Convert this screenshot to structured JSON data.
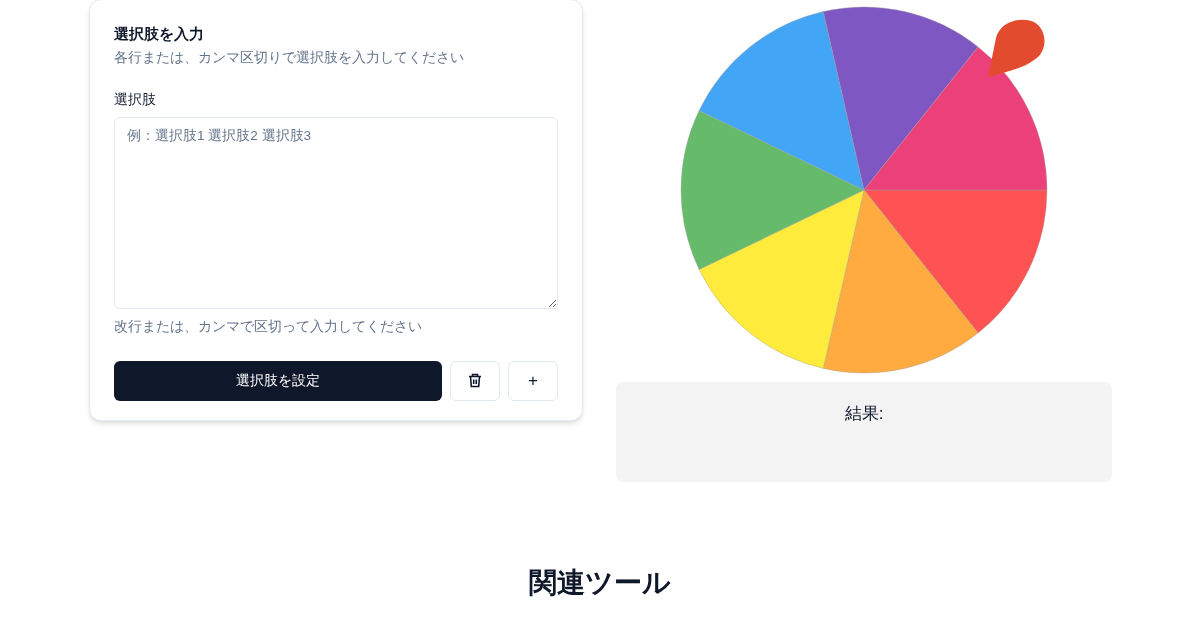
{
  "input_card": {
    "title": "選択肢を入力",
    "description": "各行または、カンマ区切りで選択肢を入力してください",
    "field_label": "選択肢",
    "placeholder": "例：選択肢1 選択肢2 選択肢3",
    "hint": "改行または、カンマで区切って入力してください",
    "submit_button": "選択肢を設定",
    "add_button": "+"
  },
  "result": {
    "label": "結果:"
  },
  "related": {
    "heading": "関連ツール"
  }
}
